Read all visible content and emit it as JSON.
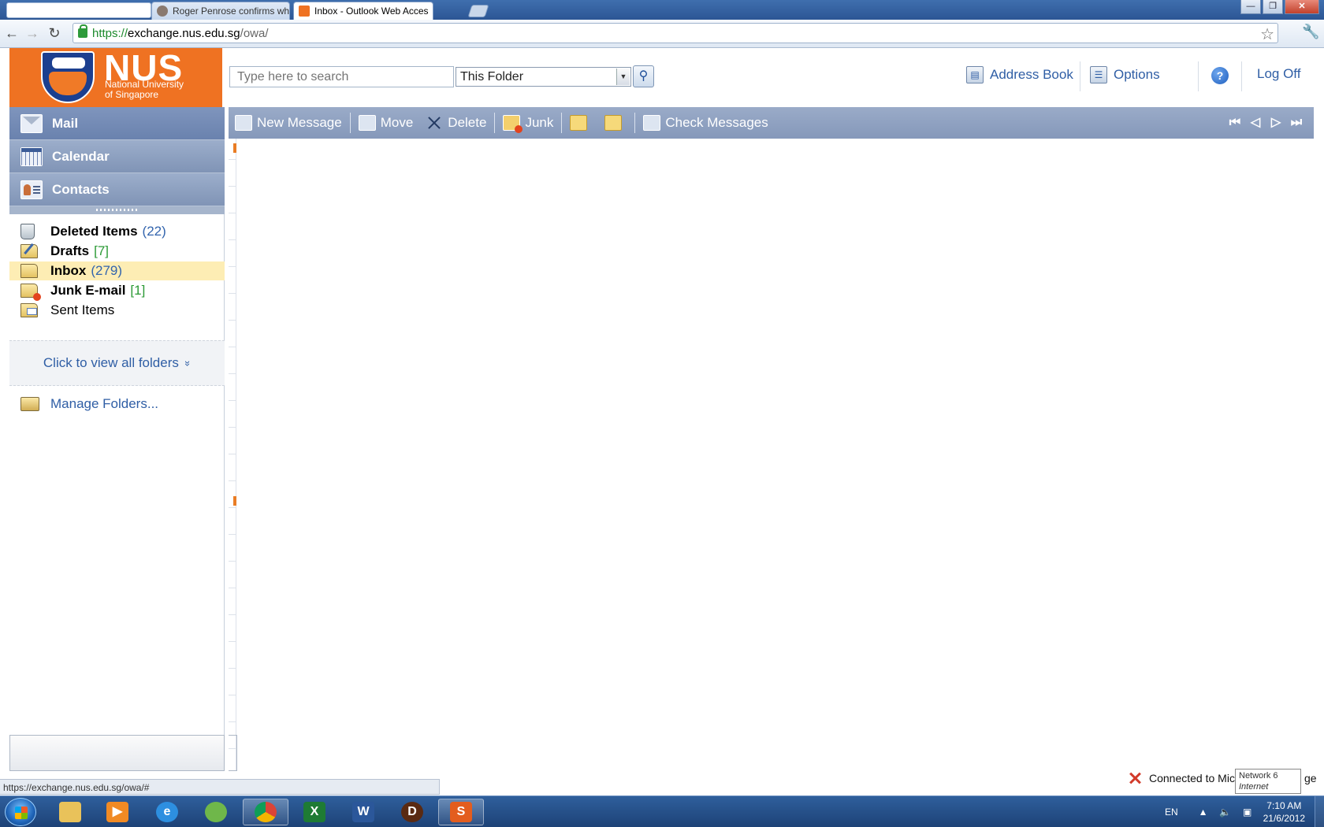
{
  "browser": {
    "tabs": [
      {
        "label": "Roger Penrose confirms wh",
        "favicon": "person-favicon"
      },
      {
        "label": "Inbox - Outlook Web Acces",
        "favicon": "nus-favicon"
      }
    ],
    "url_secure": "https://",
    "url_host": "exchange.nus.edu.sg",
    "url_path": "/owa/",
    "status_url": "https://exchange.nus.edu.sg/owa/#"
  },
  "logo": {
    "title": "NUS",
    "subtitle_line1": "National University",
    "subtitle_line2": "of Singapore",
    "color": "#ef7222"
  },
  "search": {
    "placeholder": "Type here to search",
    "scope": "This Folder"
  },
  "header_links": {
    "address_book": "Address Book",
    "options": "Options",
    "log_off": "Log Off",
    "help": "?"
  },
  "modules": {
    "mail": "Mail",
    "calendar": "Calendar",
    "contacts": "Contacts"
  },
  "folders": [
    {
      "name": "Deleted Items",
      "count": "(22)"
    },
    {
      "name": "Drafts",
      "count": "[7]"
    },
    {
      "name": "Inbox",
      "count": "(279)"
    },
    {
      "name": "Junk E-mail",
      "count": "[1]"
    },
    {
      "name": "Sent Items",
      "count": ""
    }
  ],
  "view_all_folders": "Click to view all folders",
  "manage_folders": "Manage Folders...",
  "toolbar": {
    "new_message": "New Message",
    "move": "Move",
    "delete": "Delete",
    "junk": "Junk",
    "check_messages": "Check Messages"
  },
  "status": {
    "connection": "Connected to Mic",
    "connection_tail": "ge",
    "network_line1": "Network 6",
    "network_line2": "Internet access"
  },
  "taskbar": {
    "language": "EN",
    "time": "7:10 AM",
    "date": "21/6/2012"
  },
  "colors": {
    "toolbar_blue": "#8598ba",
    "link_blue": "#2f5ea5",
    "selected_folder": "#fdedb4"
  }
}
